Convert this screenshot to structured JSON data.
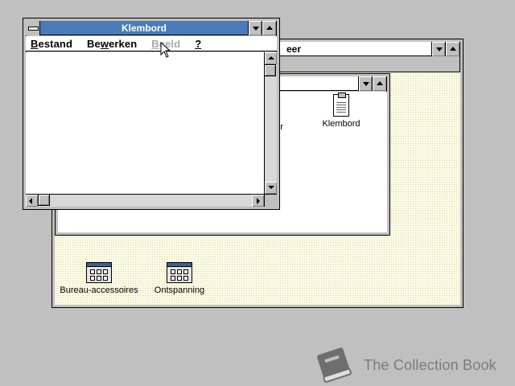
{
  "program_manager": {
    "title_partial": "eer"
  },
  "hidden_group": {
    "partial_label": "er",
    "clipboard_icon_label": "Klembord"
  },
  "group_icons": [
    {
      "label": "Bureau-accessoires",
      "icon": "program-group-icon"
    },
    {
      "label": "Ontspanning",
      "icon": "program-group-icon"
    }
  ],
  "clipboard": {
    "title": "Klembord",
    "menu": [
      {
        "label": "Bestand",
        "mnemonic": "B",
        "rest": "estand",
        "enabled": true
      },
      {
        "label": "Bewerken",
        "pre": "Be",
        "mnemonic": "w",
        "rest": "erken",
        "enabled": true
      },
      {
        "label": "Beeld",
        "mnemonic": "B",
        "rest": "eeld",
        "enabled": false
      },
      {
        "label": "?",
        "mnemonic": "?",
        "rest": "",
        "enabled": true
      }
    ]
  },
  "watermark": {
    "text": "The Collection Book",
    "icon": "book-icon"
  },
  "colors": {
    "active_title": "#4a7ab7",
    "desktop": "#c0c0c0",
    "pm_background": "#fbfbe6"
  }
}
